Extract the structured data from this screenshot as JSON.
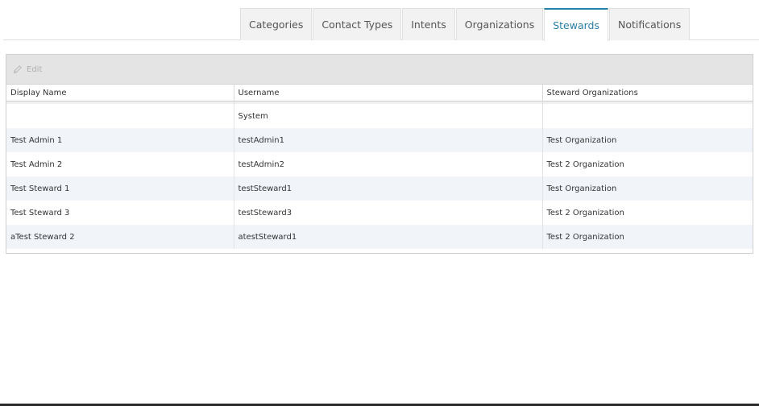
{
  "tabs": [
    {
      "label": "Categories",
      "active": false
    },
    {
      "label": "Contact Types",
      "active": false
    },
    {
      "label": "Intents",
      "active": false
    },
    {
      "label": "Organizations",
      "active": false
    },
    {
      "label": "Stewards",
      "active": true
    },
    {
      "label": "Notifications",
      "active": false
    }
  ],
  "toolbar": {
    "edit_label": "Edit",
    "edit_icon": "pencil-icon",
    "disabled_color": "#b0b0b0"
  },
  "grid": {
    "columns": [
      "Display Name",
      "Username",
      "Steward Organizations"
    ],
    "rows": [
      {
        "display_name": "",
        "username": "System",
        "organizations": ""
      },
      {
        "display_name": "Test Admin 1",
        "username": "testAdmin1",
        "organizations": "Test Organization"
      },
      {
        "display_name": "Test Admin 2",
        "username": "testAdmin2",
        "organizations": "Test 2 Organization"
      },
      {
        "display_name": "Test Steward 1",
        "username": "testSteward1",
        "organizations": "Test Organization"
      },
      {
        "display_name": "Test Steward 3",
        "username": "testSteward3",
        "organizations": "Test 2 Organization"
      },
      {
        "display_name": "aTest Steward 2",
        "username": "atestSteward1",
        "organizations": "Test 2 Organization"
      }
    ]
  },
  "colors": {
    "accent": "#2a7fa6",
    "row_alt": "#f1f5fa",
    "toolbar_bg": "#e4e4e4"
  }
}
